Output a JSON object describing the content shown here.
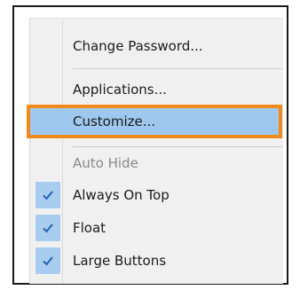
{
  "menu": {
    "items": [
      {
        "label": "Change Password...",
        "checked": false,
        "disabled": false
      },
      {
        "label": "Applications...",
        "checked": false,
        "disabled": false
      },
      {
        "label": "Customize...",
        "checked": false,
        "disabled": false,
        "highlighted": true
      },
      {
        "label": "Auto Hide",
        "checked": false,
        "disabled": true
      },
      {
        "label": "Always On Top",
        "checked": true,
        "disabled": false
      },
      {
        "label": "Float",
        "checked": true,
        "disabled": false
      },
      {
        "label": "Large Buttons",
        "checked": true,
        "disabled": false
      }
    ]
  },
  "colors": {
    "highlight_fill": "#9ec8ee",
    "highlight_border": "#f08a1c",
    "check_fill": "#a9cdf0",
    "check_mark": "#2a5fb0",
    "menu_bg": "#f0f0f0",
    "disabled_text": "#8a8a8a"
  }
}
